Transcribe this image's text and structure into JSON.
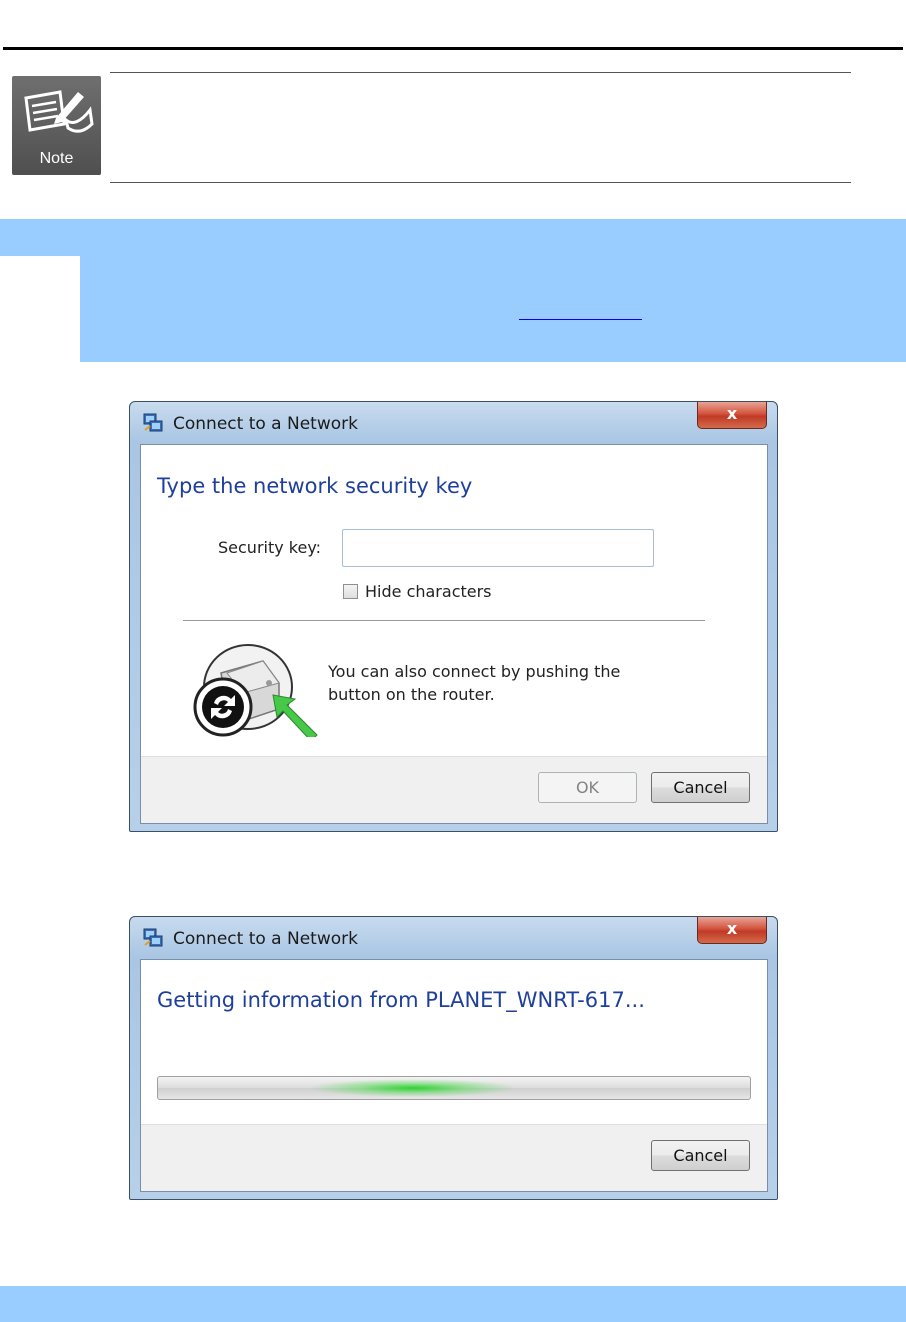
{
  "note": {
    "icon_label": "Note"
  },
  "dialog1": {
    "title": "Connect to a Network",
    "close_glyph": "x",
    "heading": "Type the network security key",
    "security_key_label": "Security key:",
    "security_key_value": "",
    "hide_characters_label": "Hide characters",
    "hide_characters_checked": false,
    "wps_text_line1": "You can also connect by pushing the",
    "wps_text_line2": "button on the router.",
    "ok_label": "OK",
    "cancel_label": "Cancel"
  },
  "dialog2": {
    "title": "Connect to a Network",
    "close_glyph": "x",
    "heading": "Getting information from PLANET_WNRT-617...",
    "cancel_label": "Cancel"
  },
  "icons": {
    "window_icon": "network-connect-icon",
    "wps_icon": "wps-router-icon",
    "note_icon": "note-pencil-icon"
  },
  "colors": {
    "band": "#99ccff",
    "heading_blue": "#1e3f9c",
    "progress_glow": "#28d228"
  }
}
